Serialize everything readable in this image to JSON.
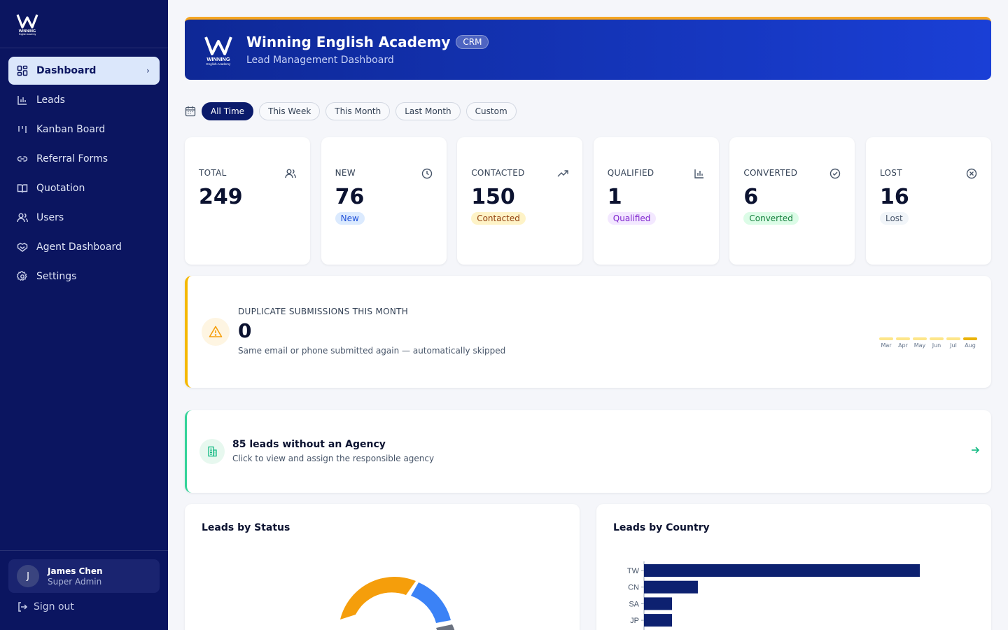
{
  "brand": {
    "logo_text": "WINNING",
    "logo_sub": "English Academy"
  },
  "sidebar": {
    "items": [
      {
        "label": "Dashboard",
        "icon": "dashboard-grid-icon",
        "active": true
      },
      {
        "label": "Leads",
        "icon": "bar-chart-icon"
      },
      {
        "label": "Kanban Board",
        "icon": "kanban-icon"
      },
      {
        "label": "Referral Forms",
        "icon": "link-icon"
      },
      {
        "label": "Quotation",
        "icon": "book-icon"
      },
      {
        "label": "Users",
        "icon": "users-icon"
      },
      {
        "label": "Agent Dashboard",
        "icon": "handshake-icon"
      },
      {
        "label": "Settings",
        "icon": "gear-icon"
      }
    ],
    "user": {
      "initial": "J",
      "name": "James Chen",
      "role": "Super Admin"
    },
    "signout_label": "Sign out"
  },
  "header": {
    "title": "Winning English Academy",
    "badge": "CRM",
    "subtitle": "Lead Management Dashboard",
    "accent_color": "#f5a623"
  },
  "filters": {
    "options": [
      "All Time",
      "This Week",
      "This Month",
      "Last Month",
      "Custom"
    ],
    "selected": "All Time"
  },
  "stats": [
    {
      "label": "TOTAL",
      "value": "249",
      "icon": "users-icon"
    },
    {
      "label": "NEW",
      "value": "76",
      "icon": "clock-icon",
      "badge": "New",
      "badge_bg": "#dbeafe",
      "badge_fg": "#1d4ed8"
    },
    {
      "label": "CONTACTED",
      "value": "150",
      "icon": "trending-up-icon",
      "badge": "Contacted",
      "badge_bg": "#fef3c7",
      "badge_fg": "#92400e"
    },
    {
      "label": "QUALIFIED",
      "value": "1",
      "icon": "bar-chart-icon",
      "badge": "Qualified",
      "badge_bg": "#f3e8ff",
      "badge_fg": "#7e22ce"
    },
    {
      "label": "CONVERTED",
      "value": "6",
      "icon": "check-circle-icon",
      "badge": "Converted",
      "badge_bg": "#dcfce7",
      "badge_fg": "#15803d"
    },
    {
      "label": "LOST",
      "value": "16",
      "icon": "x-circle-icon",
      "badge": "Lost",
      "badge_bg": "#f1f5f9",
      "badge_fg": "#475569"
    }
  ],
  "duplicates": {
    "label": "DUPLICATE SUBMISSIONS THIS MONTH",
    "value": "0",
    "description": "Same email or phone submitted again — automatically skipped",
    "months": [
      "Mar",
      "Apr",
      "May",
      "Jun",
      "Jul",
      "Aug"
    ]
  },
  "agency_banner": {
    "title": "85 leads without an Agency",
    "subtitle": "Click to view and assign the responsible agency"
  },
  "status_panel": {
    "title": "Leads by Status"
  },
  "country_panel": {
    "title": "Leads by Country"
  },
  "chart_data": [
    {
      "type": "pie",
      "title": "Leads by Status",
      "note": "donut, only the top portion is visible",
      "colors": [
        "#f59e0b",
        "#3b82f6",
        "#6b7280"
      ]
    },
    {
      "type": "bar",
      "orientation": "horizontal",
      "title": "Leads by Country",
      "categories": [
        "TW",
        "CN",
        "SA",
        "JP"
      ],
      "values": [
        128,
        25,
        13,
        13
      ],
      "color": "#0d2170"
    }
  ]
}
